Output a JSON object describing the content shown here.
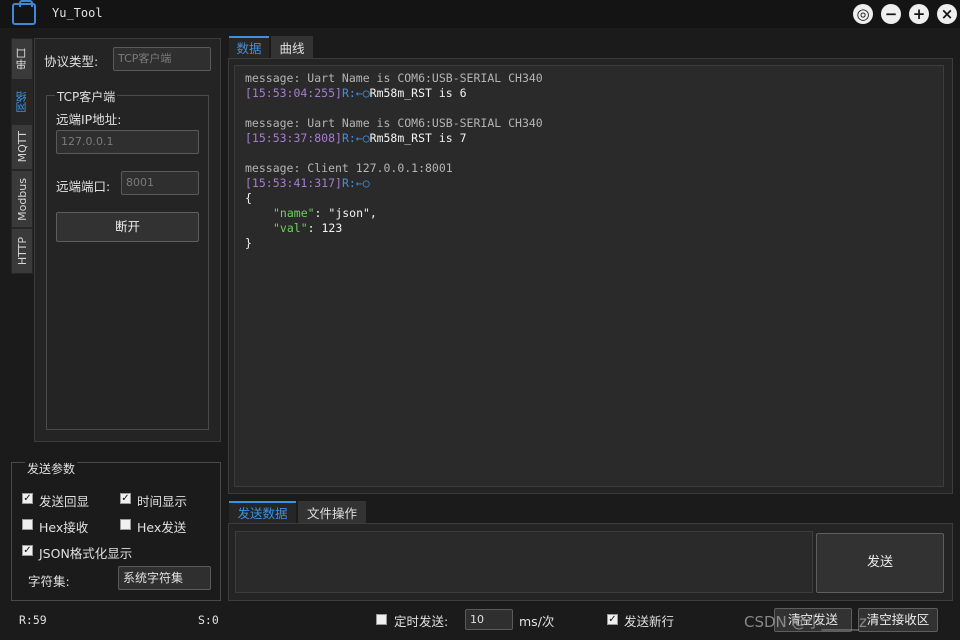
{
  "window": {
    "title": "Yu_Tool"
  },
  "side_tabs": [
    "串口",
    "网络",
    "MQTT",
    "Modbus",
    "HTTP"
  ],
  "network": {
    "protocol_label": "协议类型:",
    "protocol_placeholder": "TCP客户端",
    "group_title": "TCP客户端",
    "ip_label": "远端IP地址:",
    "ip_placeholder": "127.0.0.1",
    "port_label": "远端端口:",
    "port_placeholder": "8001",
    "disconnect_label": "断开"
  },
  "send_params": {
    "title": "发送参数",
    "echo": {
      "label": "发送回显",
      "checked": true
    },
    "time_display": {
      "label": "时间显示",
      "checked": true
    },
    "hex_recv": {
      "label": "Hex接收",
      "checked": false
    },
    "hex_send": {
      "label": "Hex发送",
      "checked": false
    },
    "json_format": {
      "label": "JSON格式化显示",
      "checked": true
    },
    "charset_label": "字符集:",
    "charset_value": "系统字符集"
  },
  "top_tabs": [
    "数据",
    "曲线"
  ],
  "receive": {
    "lines": [
      {
        "msg": "message: Uart Name is COM6:USB-SERIAL CH340"
      },
      {
        "ts": "[15:53:04:255]",
        "dir": "R:←○",
        "body": "Rm58m_RST is 6"
      },
      {
        "msg": "message: Uart Name is COM6:USB-SERIAL CH340"
      },
      {
        "ts": "[15:53:37:808]",
        "dir": "R:←○",
        "body": "Rm58m_RST is 7"
      },
      {
        "msg": "message: Client 127.0.0.1:8001"
      },
      {
        "ts": "[15:53:41:317]",
        "dir": "R:←○"
      }
    ],
    "json_open": "{",
    "json_name_key": "\"name\"",
    "json_name_value": ": \"json\",",
    "json_val_key": "\"val\"",
    "json_val_value": ": 123",
    "json_close": "}"
  },
  "bottom_tabs": [
    "发送数据",
    "文件操作"
  ],
  "send_button_label": "发送",
  "status": {
    "r_count": "R:59",
    "s_count": "S:0",
    "timer_label": "定时发送:",
    "timer_checked": false,
    "timer_value": "10",
    "timer_unit": "ms/次",
    "newline_label": "发送新行",
    "newline_checked": true,
    "clear_send_label": "清空发送",
    "clear_recv_label": "清空接收区"
  },
  "watermark": "CSDN @小_____z",
  "colors": {
    "accent": "#3d8fe0",
    "timestamp": "#a67cd0",
    "json_key": "#6fcf5f"
  }
}
